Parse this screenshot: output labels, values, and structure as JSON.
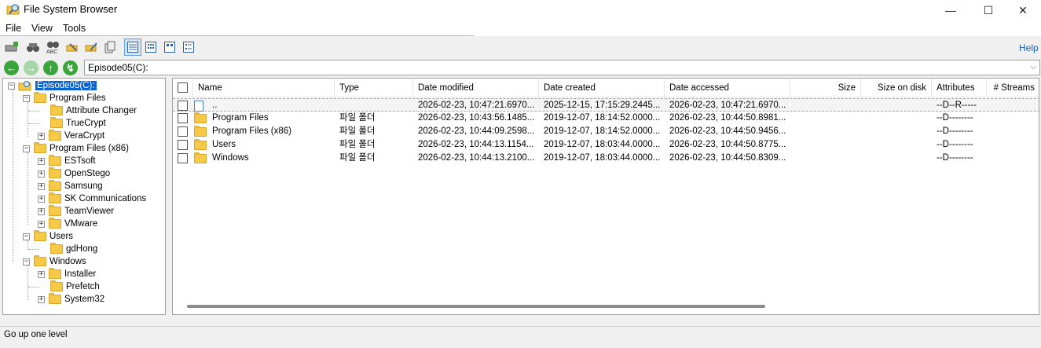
{
  "window": {
    "title": "File System Browser",
    "minimize": "—",
    "maximize": "☐",
    "close": "✕"
  },
  "menu": {
    "file": "File",
    "view": "View",
    "tools": "Tools"
  },
  "toolbar": {
    "help": "Help",
    "buttons": [
      "add-drive-icon",
      "binoculars-icon",
      "abc-search-icon",
      "wrench-icon",
      "edit-icon",
      "copy-icon",
      "details-view-icon",
      "grid-view-icon",
      "large-icons-view-icon",
      "list-view-icon"
    ]
  },
  "address": {
    "value": "Episode05(C):"
  },
  "tree": {
    "root": "Episode05(C):",
    "program_files": "Program Files",
    "attribute_changer": "Attribute Changer",
    "truecrypt": "TrueCrypt",
    "veracrypt": "VeraCrypt",
    "program_files_x86": "Program Files (x86)",
    "estsoft": "ESTsoft",
    "openstego": "OpenStego",
    "samsung": "Samsung",
    "sk_communications": "SK Communications",
    "teamviewer": "TeamViewer",
    "vmware": "VMware",
    "users": "Users",
    "gdhong": "gdHong",
    "windows": "Windows",
    "installer": "Installer",
    "prefetch": "Prefetch",
    "system32": "System32"
  },
  "columns": {
    "name": "Name",
    "type": "Type",
    "date_modified": "Date modified",
    "date_created": "Date created",
    "date_accessed": "Date accessed",
    "size": "Size",
    "size_on_disk": "Size on disk",
    "attributes": "Attributes",
    "streams": "# Streams"
  },
  "rows": [
    {
      "name": "..",
      "type": "",
      "modified": "2026-02-23, 10:47:21.6970...",
      "created": "2025-12-15, 17:15:29.2445...",
      "accessed": "2026-02-23, 10:47:21.6970...",
      "attributes": "--D--R-----"
    },
    {
      "name": "Program Files",
      "type": "파일 폴더",
      "modified": "2026-02-23, 10:43:56.1485...",
      "created": "2019-12-07, 18:14:52.0000...",
      "accessed": "2026-02-23, 10:44:50.8981...",
      "attributes": "--D--------"
    },
    {
      "name": "Program Files (x86)",
      "type": "파일 폴더",
      "modified": "2026-02-23, 10:44:09.2598...",
      "created": "2019-12-07, 18:14:52.0000...",
      "accessed": "2026-02-23, 10:44:50.9456...",
      "attributes": "--D--------"
    },
    {
      "name": "Users",
      "type": "파일 폴더",
      "modified": "2026-02-23, 10:44:13.1154...",
      "created": "2019-12-07, 18:03:44.0000...",
      "accessed": "2026-02-23, 10:44:50.8775...",
      "attributes": "--D--------"
    },
    {
      "name": "Windows",
      "type": "파일 폴더",
      "modified": "2026-02-23, 10:44:13.2100...",
      "created": "2019-12-07, 18:03:44.0000...",
      "accessed": "2026-02-23, 10:44:50.8309...",
      "attributes": "--D--------"
    }
  ],
  "status": {
    "text": "Go up one level"
  }
}
